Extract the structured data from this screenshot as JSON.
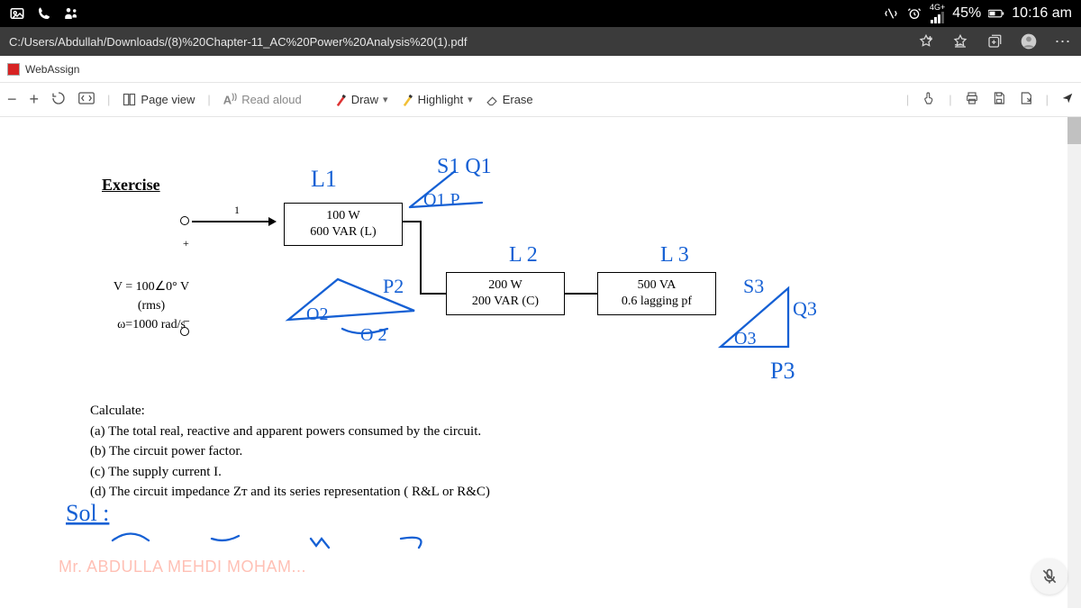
{
  "status": {
    "signal_label": "4G+",
    "battery": "45%",
    "time": "10:16 am"
  },
  "address_bar": {
    "url": "C:/Users/Abdullah/Downloads/(8)%20Chapter-11_AC%20Power%20Analysis%20(1).pdf"
  },
  "tab": {
    "title": "WebAssign"
  },
  "toolbar": {
    "page_view": "Page view",
    "read_aloud": "Read aloud",
    "draw": "Draw",
    "highlight": "Highlight",
    "erase": "Erase"
  },
  "doc": {
    "exercise_heading": "Exercise",
    "one_label": "1",
    "plus": "+",
    "minus": "−",
    "box1": {
      "line1": "100 W",
      "line2": "600 VAR (L)"
    },
    "box2": {
      "line1": "200 W",
      "line2": "200 VAR (C)"
    },
    "box3": {
      "line1": "500 VA",
      "line2": "0.6 lagging pf"
    },
    "source": {
      "line1": "V = 100∠0° V",
      "line2": "(rms)",
      "line3": "ω=1000 rad/s"
    },
    "calculate_heading": "Calculate:",
    "items": {
      "a": "(a) The total real, reactive and apparent powers consumed by the circuit.",
      "b": "(b) The circuit power factor.",
      "c": "(c) The supply current I.",
      "d": "(d) The circuit impedance Zᴛ and its series representation ( R&L or R&C)"
    },
    "watermark": "Mr. ABDULLA MEHDI MOHAM...",
    "ink_labels": {
      "L1": "L1",
      "S1Q1": "S1  Q1",
      "O1P": "O1  P",
      "L2": "L 2",
      "L3": "L 3",
      "P2": "P2",
      "O2": "O2",
      "O2r": "O 2",
      "S3": "S3",
      "Q3": "Q3",
      "O3": "O3",
      "P3": "P3",
      "sol": "Sol :"
    }
  }
}
